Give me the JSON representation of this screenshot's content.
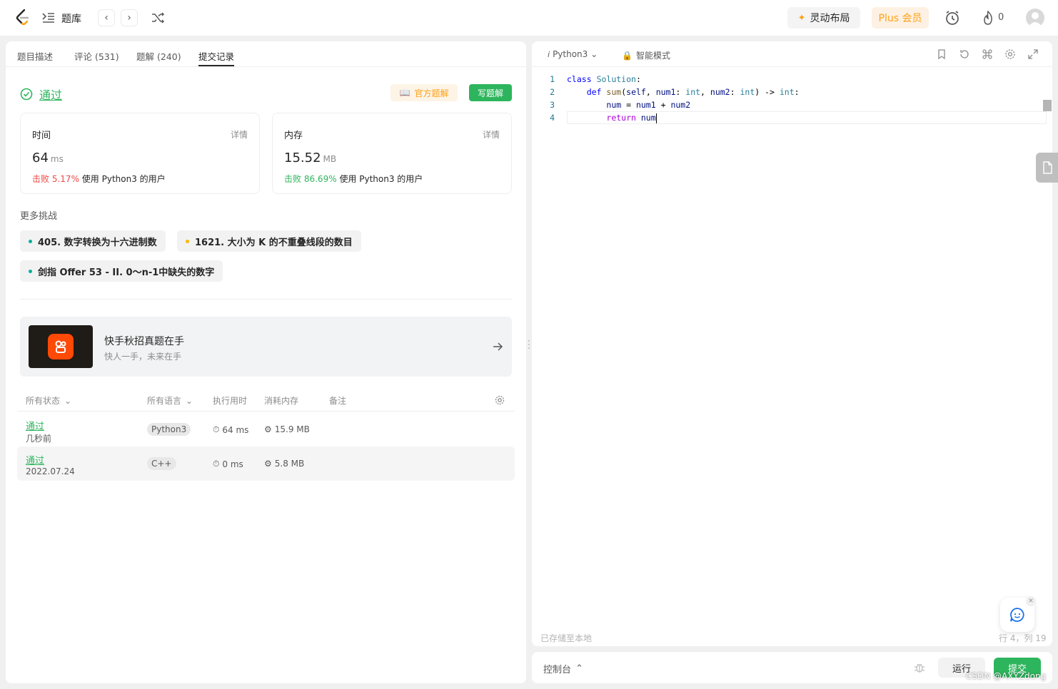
{
  "nav": {
    "title": "题库",
    "lingdong_label": "灵动布局",
    "plus_label": "Plus 会员",
    "fire_count": "0"
  },
  "tabs": [
    {
      "label": "题目描述"
    },
    {
      "label": "评论 (531)"
    },
    {
      "label": "题解 (240)"
    },
    {
      "label": "提交记录"
    }
  ],
  "result": {
    "status": "通过",
    "official_label": "官方题解",
    "write_label": "写题解"
  },
  "stats": {
    "time": {
      "title": "时间",
      "detail": "详情",
      "value": "64",
      "unit": "ms",
      "beat_prefix": "击败",
      "beat_pct": "5.17%",
      "beat_suffix": "使用 Python3 的用户"
    },
    "memory": {
      "title": "内存",
      "detail": "详情",
      "value": "15.52",
      "unit": "MB",
      "beat_prefix": "击败",
      "beat_pct": "86.69%",
      "beat_suffix": "使用 Python3 的用户"
    }
  },
  "more": {
    "title": "更多挑战",
    "items": [
      {
        "label": "405. 数字转换为十六进制数",
        "color": "#00af9b"
      },
      {
        "label": "1621. 大小为 K 的不重叠线段的数目",
        "color": "#ffb800"
      },
      {
        "label": "剑指 Offer 53 - II. 0～n-1中缺失的数字",
        "color": "#00af9b"
      }
    ]
  },
  "banner": {
    "title": "快手秋招真题在手",
    "subtitle": "快人一手，未来在手"
  },
  "table": {
    "headers": {
      "status": "所有状态",
      "language": "所有语言",
      "runtime": "执行用时",
      "memory": "消耗内存",
      "note": "备注"
    },
    "rows": [
      {
        "status": "通过",
        "time": "几秒前",
        "language": "Python3",
        "runtime": "64 ms",
        "memory": "15.9 MB"
      },
      {
        "status": "通过",
        "time": "2022.07.24",
        "language": "C++",
        "runtime": "0 ms",
        "memory": "5.8 MB"
      }
    ]
  },
  "editor": {
    "language": "Python3",
    "mode": "智能模式",
    "saved": "已存储至本地",
    "position": "行 4，列 19",
    "line_numbers": [
      "1",
      "2",
      "3",
      "4"
    ]
  },
  "console": {
    "label": "控制台",
    "run_label": "运行",
    "submit_label": "提交"
  },
  "watermark": "CSDN @AXYZdong",
  "colors": {
    "accent_green": "#2db55d",
    "accent_orange": "#ffa116",
    "beat_red": "#ef4743"
  }
}
